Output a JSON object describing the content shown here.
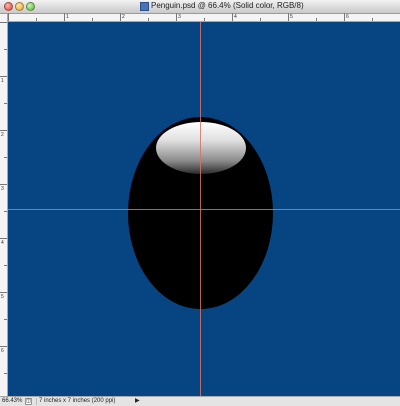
{
  "window": {
    "title": "Penguin.psd @ 66.4% (Solid color, RGB/8)"
  },
  "rulers": {
    "top_numbers": [
      "1",
      "2",
      "3",
      "4",
      "5",
      "6"
    ],
    "left_numbers": [
      "1",
      "2",
      "3",
      "4",
      "5",
      "6"
    ]
  },
  "status": {
    "zoom": "66.43%",
    "doc_info": "7 inches x 7 inches (200 ppi)",
    "arrow": "▶",
    "icon": "◫"
  },
  "colors": {
    "background": "#064482",
    "guide": "#d0766a",
    "body": "#000000"
  },
  "icons": [
    "close-icon",
    "minimize-icon",
    "zoom-icon",
    "document-icon",
    "popup-arrow-icon"
  ]
}
